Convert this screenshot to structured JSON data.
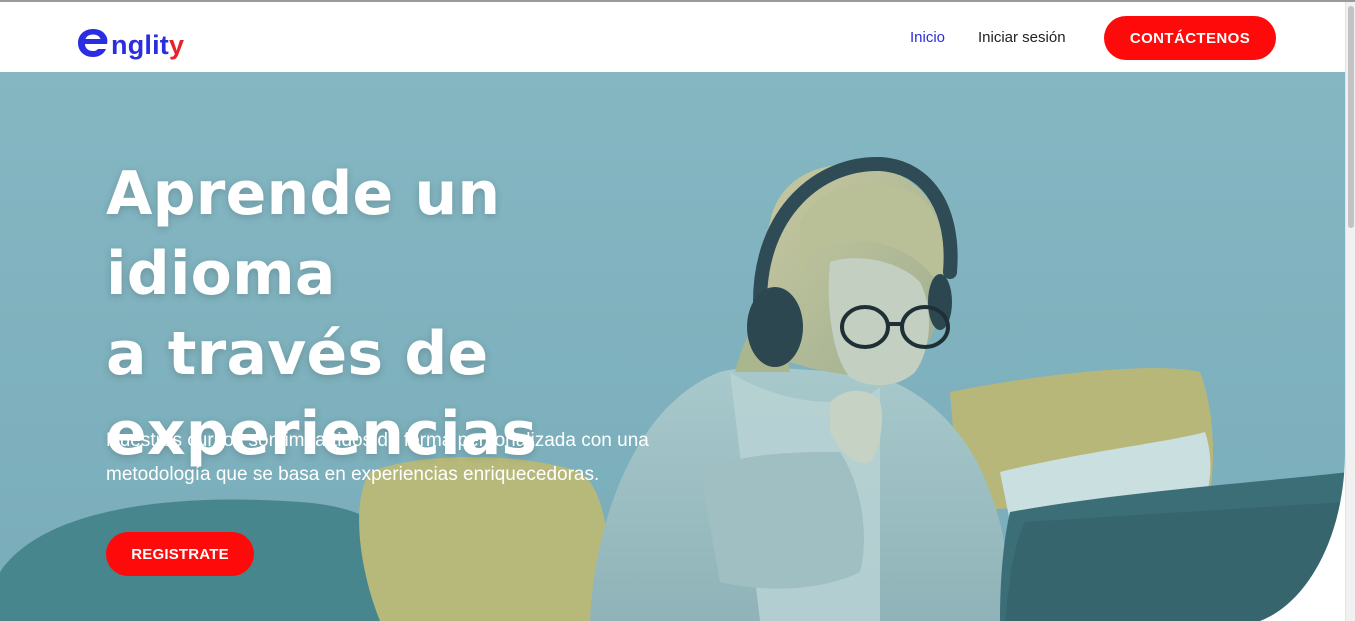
{
  "logo": {
    "text_blue": "nglit",
    "text_red": "y",
    "blue_color": "#2a2ee0",
    "red_color": "#e8222a"
  },
  "nav": {
    "items": [
      {
        "label": "Inicio",
        "active": true
      },
      {
        "label": "Iniciar sesión",
        "active": false
      }
    ],
    "contact_label": "CONTÁCTENOS"
  },
  "hero": {
    "title_lines": [
      "Aprende un idioma",
      "a través de",
      "experiencias"
    ],
    "subtitle": "Nuestros cursos son impartidos de forma personalizada con una metodología que se basa en experiencias enriquecedoras.",
    "cta_label": "REGISTRATE"
  },
  "colors": {
    "accent": "#ff0a0a",
    "link_active": "#2b2fd6",
    "hero_overlay": "#79aebb"
  }
}
